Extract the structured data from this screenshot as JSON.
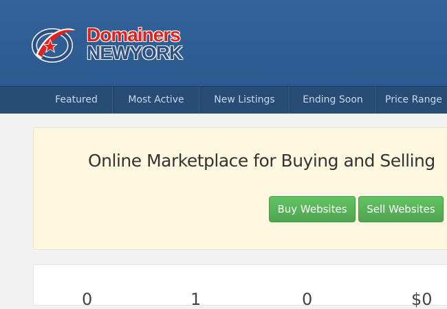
{
  "logo": {
    "line1": "Domainers",
    "line2": "NEWYORK",
    "icon": "star-orbit-logo-icon"
  },
  "nav": {
    "items": [
      {
        "label": "Featured"
      },
      {
        "label": "Most Active"
      },
      {
        "label": "New Listings"
      },
      {
        "label": "Ending Soon"
      },
      {
        "label": "Price Range"
      }
    ]
  },
  "hero": {
    "title": "Online Marketplace for Buying and Selling",
    "buy_label": "Buy Websites",
    "sell_label": "Sell Websites"
  },
  "stats": {
    "values": [
      "0",
      "1",
      "0",
      "$0"
    ]
  },
  "colors": {
    "header": "#33639a",
    "nav": "#274d77",
    "hero_bg": "#fdf8df",
    "button_green": "#5cb85c",
    "logo_red": "#e2211c",
    "logo_blue": "#2c4f87"
  }
}
